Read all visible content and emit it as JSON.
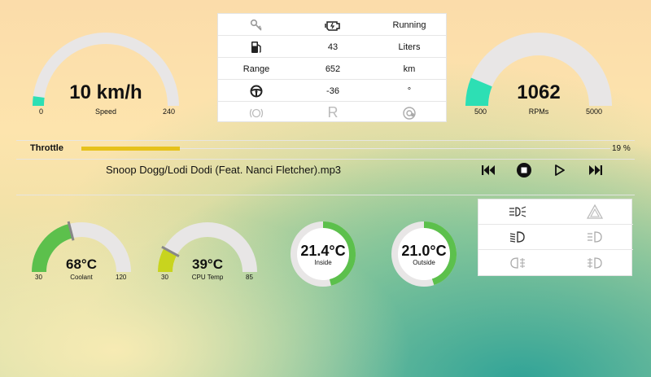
{
  "speed_gauge": {
    "value": "10 km/h",
    "label": "Speed",
    "min": "0",
    "max": "240",
    "level": 0.042
  },
  "rpm_gauge": {
    "value": "1062",
    "label": "RPMs",
    "min": "500",
    "max": "5000",
    "level": 0.125
  },
  "info": {
    "status": "Running",
    "fuel_value": "43",
    "fuel_unit": "Liters",
    "range_label": "Range",
    "range_value": "652",
    "range_unit": "km",
    "steering_value": "-36",
    "steering_unit": "°",
    "gear": "R"
  },
  "throttle": {
    "label": "Throttle",
    "percent_text": "19 %",
    "level": 0.19
  },
  "media": {
    "track": "Snoop Dogg/Lodi Dodi (Feat. Nanci Fletcher).mp3"
  },
  "coolant_gauge": {
    "value": "68°C",
    "label": "Coolant",
    "min": "30",
    "max": "120",
    "level": 0.42
  },
  "cpu_gauge": {
    "value": "39°C",
    "label": "CPU Temp",
    "min": "30",
    "max": "85",
    "level": 0.16
  },
  "inside_temp": {
    "value": "21.4°C",
    "label": "Inside",
    "level": 0.46
  },
  "outside_temp": {
    "value": "21.0°C",
    "label": "Outside",
    "level": 0.45
  },
  "colors": {
    "gauge_track": "#e8e6e6",
    "speed_fill": "#2ddfb4",
    "rpm_fill": "#2ddfb4",
    "temp_fill": "#5cc04c",
    "cpu_fill": "#c8d41e",
    "throttle_fill": "#e6c21b",
    "needle": "#888888"
  },
  "icons": {
    "key": "key-icon",
    "engine": "check-engine-icon",
    "fuel": "fuel-pump-icon",
    "steering": "steering-wheel-icon",
    "parking_brake": "parking-brake-icon",
    "abs": "abs-icon",
    "lights": [
      "fog-light-icon",
      "hazard-icon",
      "low-beam-icon",
      "parking-light-icon",
      "rear-fog-icon",
      "front-fog-icon"
    ]
  }
}
